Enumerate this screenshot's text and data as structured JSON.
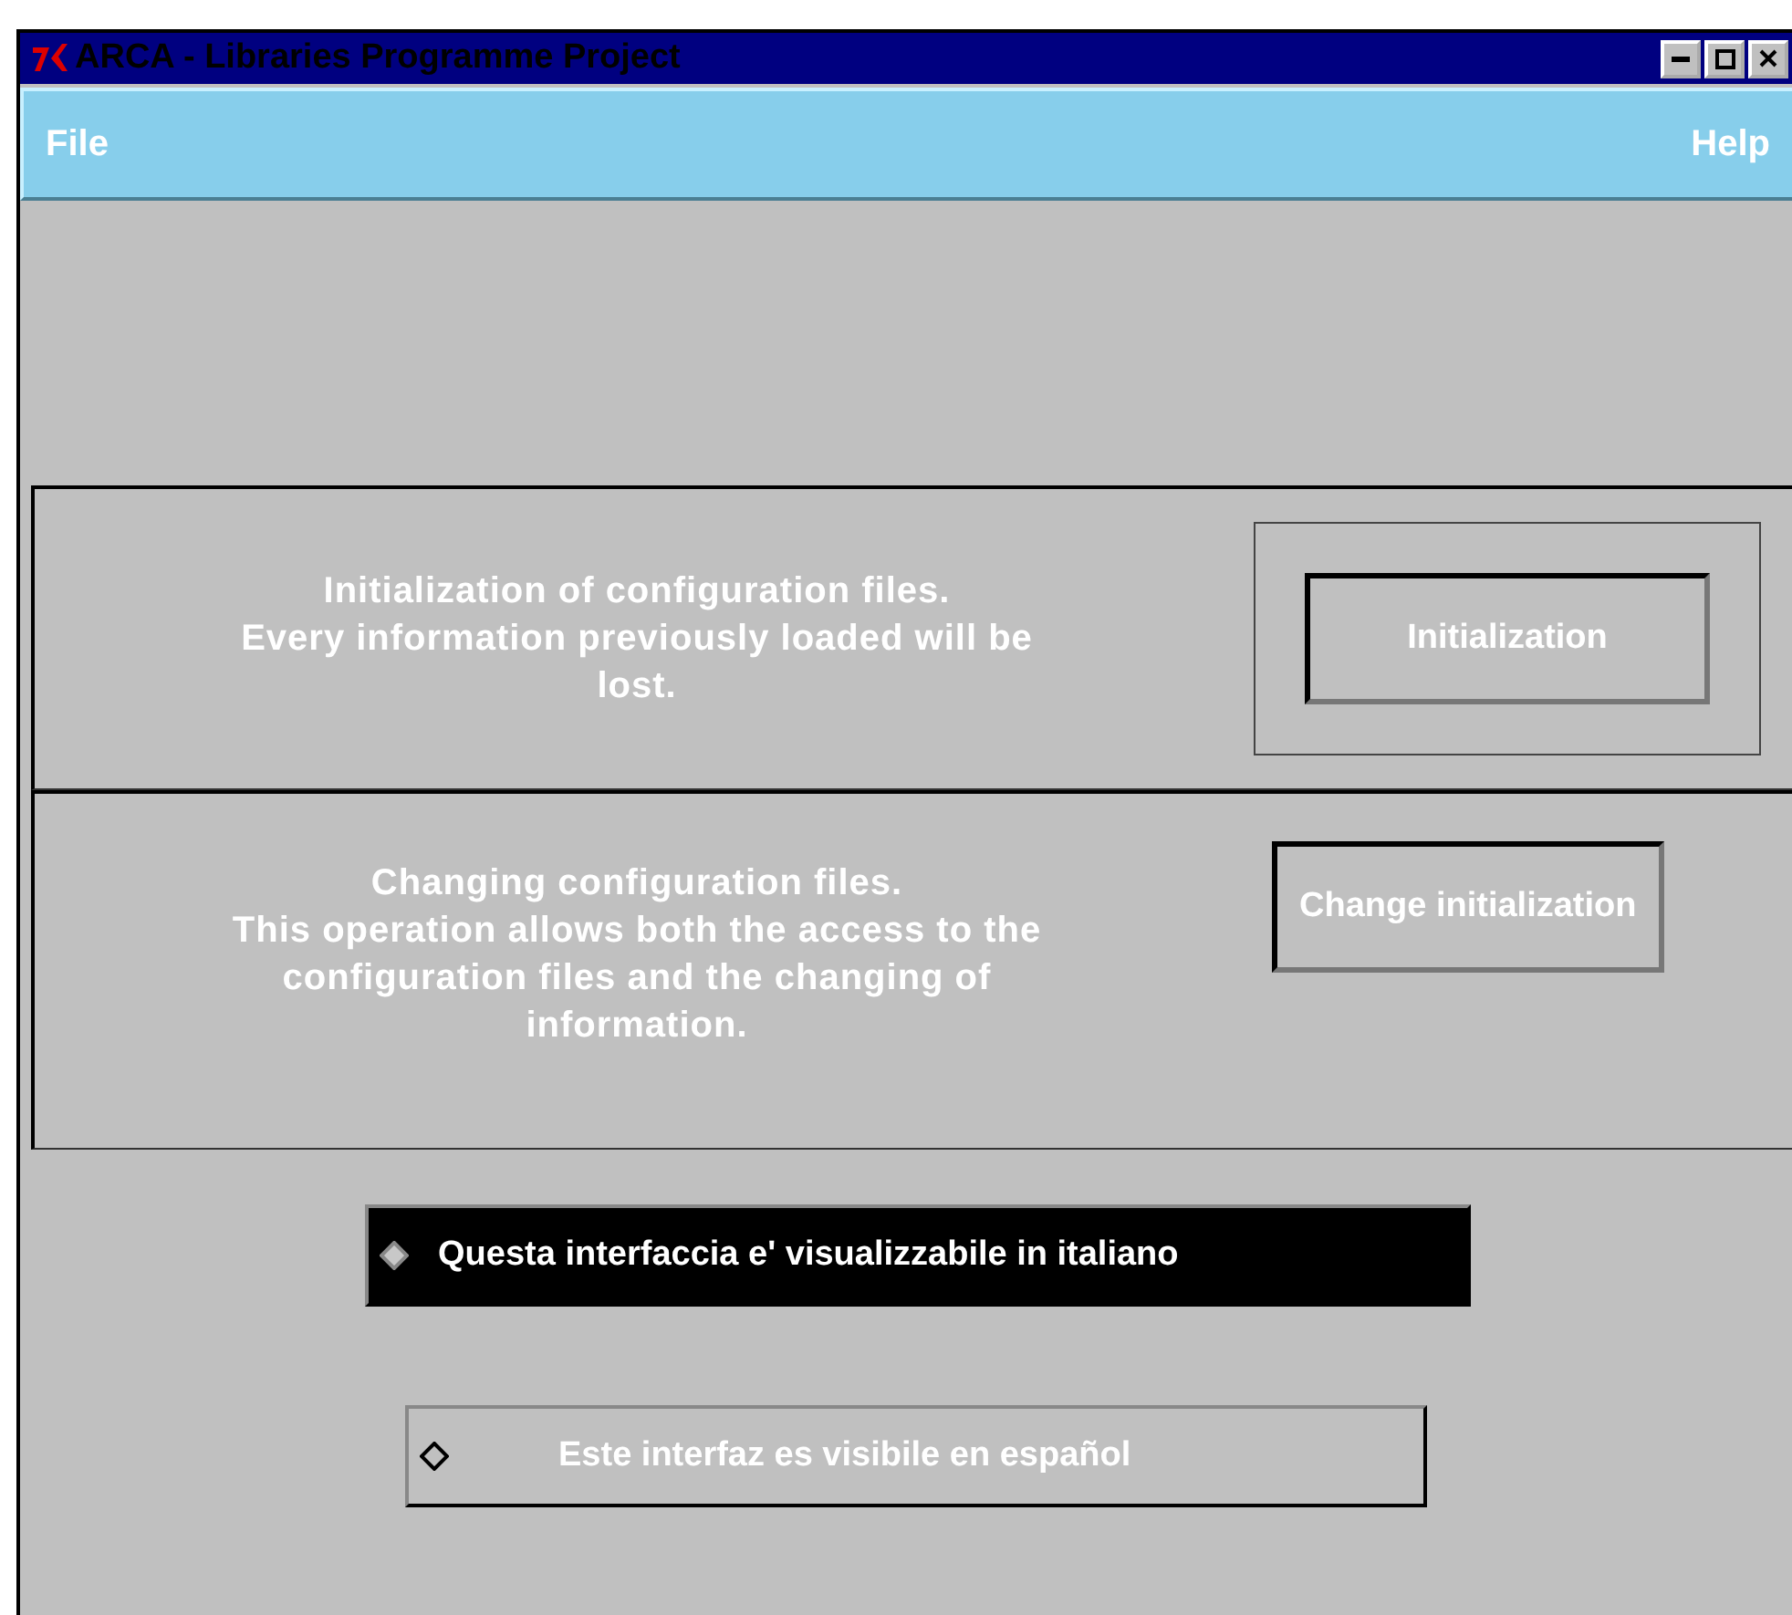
{
  "window": {
    "title": "ARCA - Libraries Programme Project"
  },
  "menu": [
    {
      "label": "File"
    },
    {
      "label": "Help"
    }
  ],
  "sections": [
    {
      "lines": [
        "Initialization of configuration files.",
        "Every information previously loaded will be",
        "lost."
      ],
      "button": "Initialization",
      "framed": true
    },
    {
      "lines": [
        "Changing configuration files.",
        "This operation allows both the access to the",
        "configuration files and the changing of",
        "information."
      ],
      "button": "Change initialization",
      "framed": false
    }
  ],
  "languages": [
    {
      "label": "Questa interfaccia e' visualizzabile in italiano",
      "selected": true
    },
    {
      "label": "Este interfaz es visibile en español",
      "selected": false
    }
  ]
}
